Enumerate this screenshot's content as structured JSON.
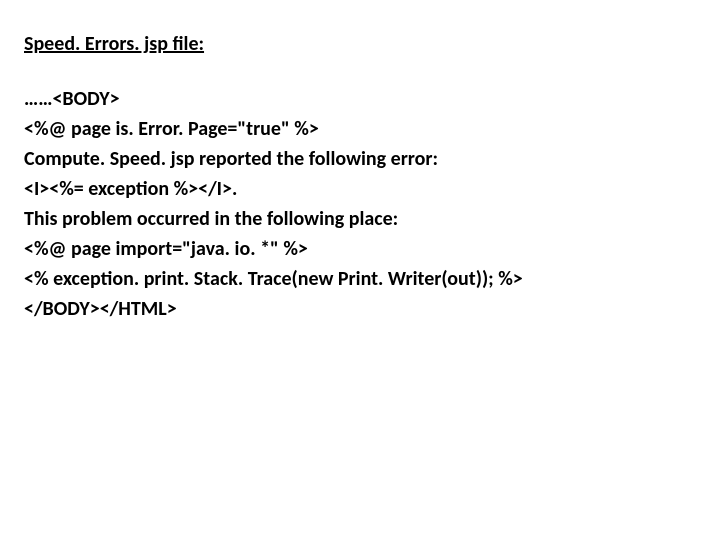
{
  "title": "Speed. Errors. jsp  file:",
  "code": {
    "line1": "……<BODY>",
    "line2": "<%@ page is. Error. Page=\"true\" %>",
    "line3": "Compute. Speed. jsp reported the following error:",
    "line4": "<I><%= exception %></I>.",
    "line5": "This problem occurred in the following place:",
    "line6": "<%@ page import=\"java. io. *\" %>",
    "line7": "<% exception. print. Stack. Trace(new Print. Writer(out)); %>",
    "line8": "</BODY></HTML>"
  }
}
